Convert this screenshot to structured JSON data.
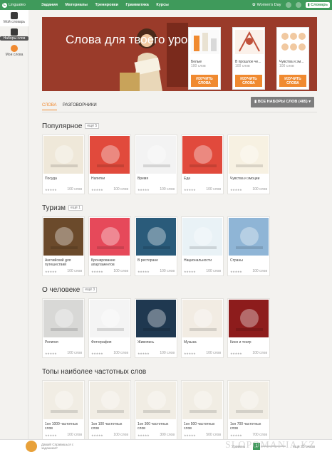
{
  "topbar": {
    "logo": "Lingualeo",
    "nav": [
      "Задания",
      "Материалы",
      "Тренировки",
      "Грамматика",
      "Курсы"
    ],
    "event": "Women's Day",
    "dictionary_button": "Словарь"
  },
  "sidebar": {
    "items": [
      {
        "label": "Мой словарь"
      },
      {
        "label": "Наборы слов"
      },
      {
        "label": "Мои слова"
      }
    ]
  },
  "banner": {
    "title": "Слова для твоего уровня",
    "cards": [
      {
        "title": "Белые",
        "words": "100 слов",
        "button": "ИЗУЧИТЬ СЛОВА"
      },
      {
        "title": "В прошлое че...",
        "words": "100 слов",
        "button": "ИЗУЧИТЬ СЛОВА"
      },
      {
        "title": "Чувства и эм...",
        "words": "100 слов",
        "button": "ИЗУЧИТЬ СЛОВА"
      }
    ]
  },
  "tabs": {
    "items": [
      "СЛОВА",
      "РАЗГОВОРНИКИ"
    ],
    "all_sets": "ВСЕ НАБОРЫ СЛОВ (485)"
  },
  "sections": [
    {
      "title": "Популярное",
      "more": "ещё 5",
      "cards": [
        {
          "name": "Посуда",
          "stars": "★★★★★",
          "count": "100 слов",
          "color": "#efe8d9"
        },
        {
          "name": "Напитки",
          "stars": "★★★★★",
          "count": "100 слов",
          "color": "#e14a3c"
        },
        {
          "name": "Время",
          "stars": "★★★★★",
          "count": "100 слов",
          "color": "#f3f3f3"
        },
        {
          "name": "Еда",
          "stars": "★★★★★",
          "count": "100 слов",
          "color": "#e14a3c"
        },
        {
          "name": "Чувства и эмоции",
          "stars": "★★★★★",
          "count": "100 слов",
          "color": "#f7f1e2"
        }
      ]
    },
    {
      "title": "Туризм",
      "more": "ещё 1",
      "cards": [
        {
          "name": "Английский для путешествий",
          "stars": "★★★★★",
          "count": "100 слов",
          "color": "#6b4a2b"
        },
        {
          "name": "Бронирование апартаментов",
          "stars": "★★★★★",
          "count": "100 слов",
          "color": "#e6495a"
        },
        {
          "name": "В ресторане",
          "stars": "★★★★★",
          "count": "100 слов",
          "color": "#2a5b7a"
        },
        {
          "name": "Национальности",
          "stars": "★★★★★",
          "count": "100 слов",
          "color": "#e9f2f6"
        },
        {
          "name": "Страны",
          "stars": "★★★★★",
          "count": "100 слов",
          "color": "#8fb5d6"
        }
      ]
    },
    {
      "title": "О человеке",
      "more": "ещё 3",
      "cards": [
        {
          "name": "Религия",
          "stars": "★★★★★",
          "count": "100 слов",
          "color": "#d8d8d6"
        },
        {
          "name": "Фотография",
          "stars": "★★★★★",
          "count": "100 слов",
          "color": "#f4f4f4"
        },
        {
          "name": "Живопись",
          "stars": "★★★★★",
          "count": "100 слов",
          "color": "#1f3850"
        },
        {
          "name": "Музыка",
          "stars": "★★★★★",
          "count": "100 слов",
          "color": "#f2ece3"
        },
        {
          "name": "Кино и театр",
          "stars": "★★★★★",
          "count": "100 слов",
          "color": "#8d1c1c"
        }
      ]
    },
    {
      "title": "Топы наиболее частотных слов",
      "more": "",
      "cards": [
        {
          "name": "1он 1000 частотных слов",
          "stars": "★★★★★",
          "count": "100 слов",
          "color": "#f1ede4"
        },
        {
          "name": "1он 100 частотных слов",
          "stars": "★★★★★",
          "count": "100 слов",
          "color": "#f1ede4"
        },
        {
          "name": "1он 300 частотных слов",
          "stars": "★★★★★",
          "count": "300 слов",
          "color": "#f1ede4"
        },
        {
          "name": "1он 500 частотных слов",
          "stars": "★★★★★",
          "count": "500 слов",
          "color": "#f1ede4"
        },
        {
          "name": "1он 700 частотных слов",
          "stars": "★★★★★",
          "count": "700 слов",
          "color": "#f1ede4"
        }
      ]
    }
  ],
  "footer": {
    "message": "Давай! Справишься с заданием?",
    "level_label": "Уровень",
    "level": "1",
    "points": "ещё 25 очков"
  },
  "watermark": "SLOPOMANIA.KZ"
}
